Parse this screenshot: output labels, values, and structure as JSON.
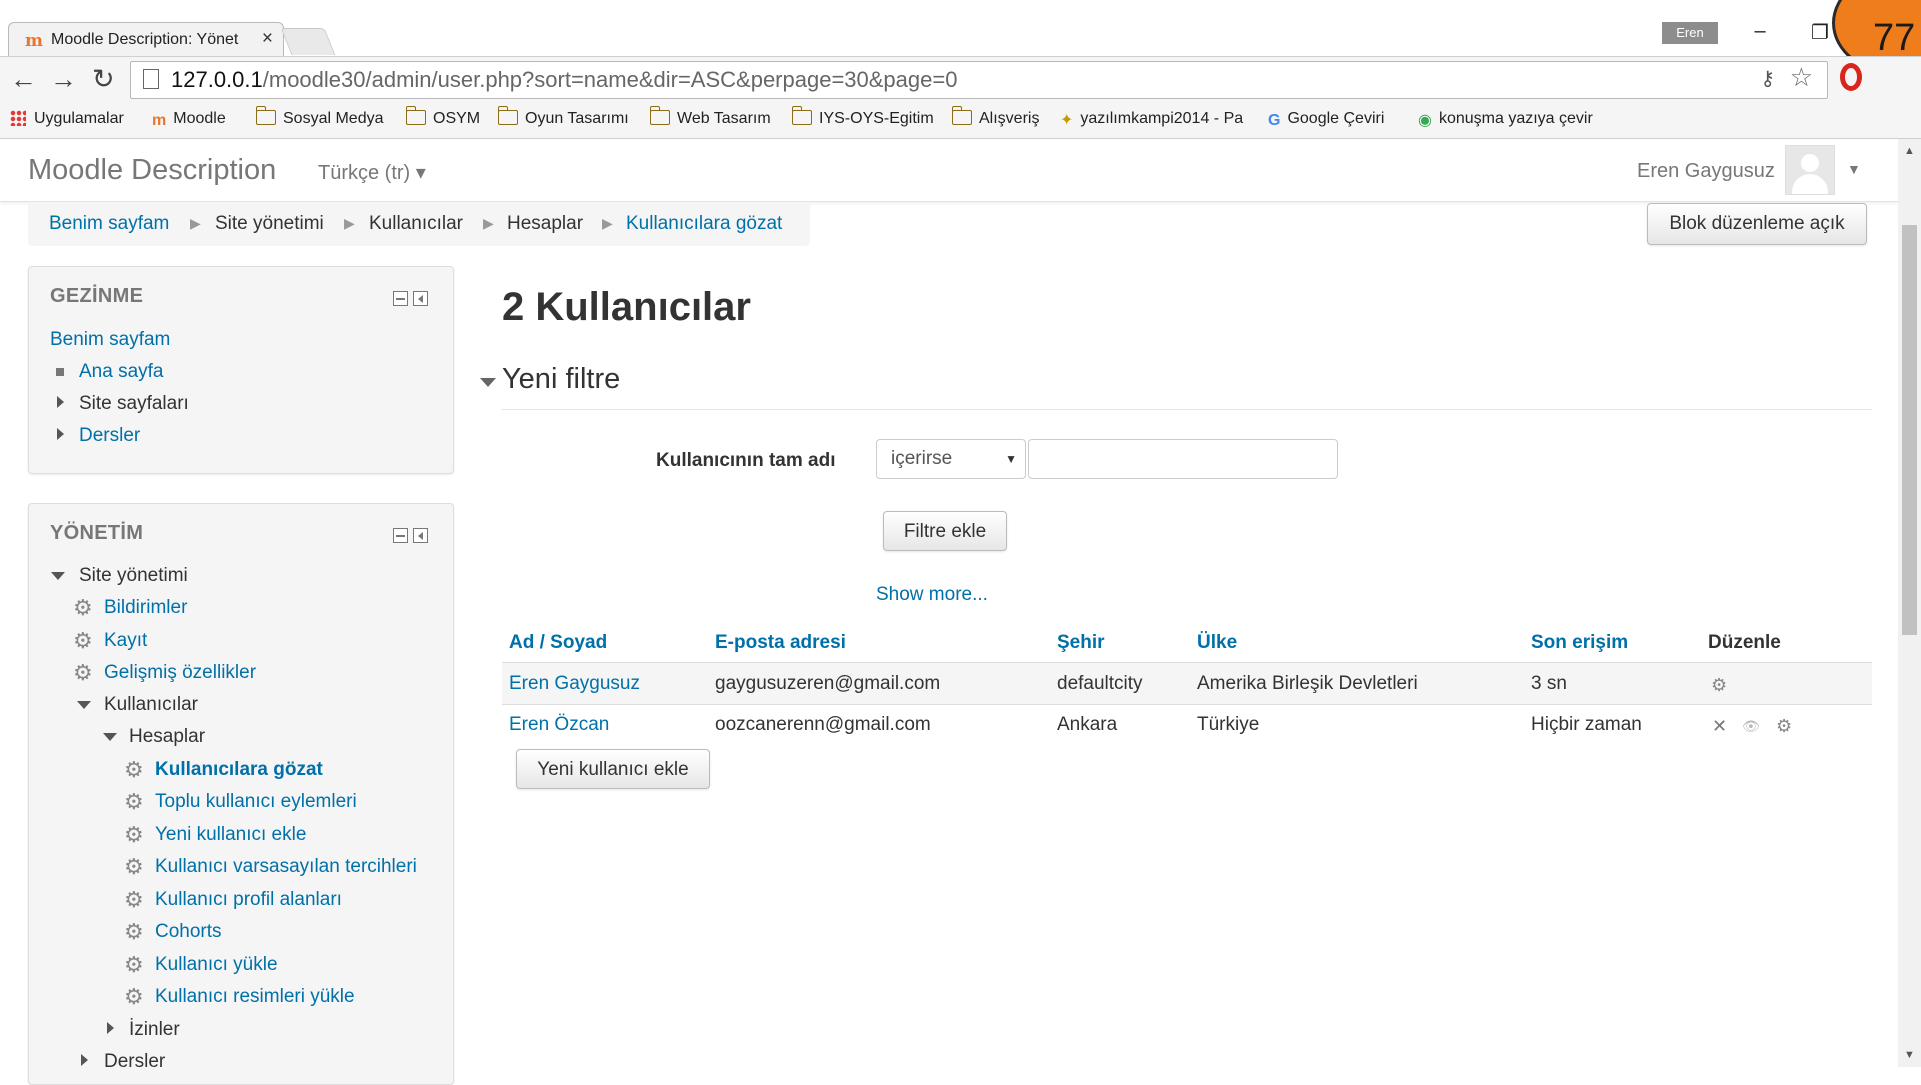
{
  "browser": {
    "tab_title": "Moodle Description: Yönet",
    "tab_close": "×",
    "profile_name": "Eren",
    "notification_count": "77",
    "url_host": "127.0.0.1",
    "url_path": "/moodle30/admin/user.php?sort=name&dir=ASC&perpage=30&page=0",
    "bookmarks": {
      "apps": "Uygulamalar",
      "moodle": "Moodle",
      "sosyal": "Sosyal Medya",
      "osym": "OSYM",
      "oyun": "Oyun Tasarımı",
      "web": "Web Tasarım",
      "iys": "IYS-OYS-Egitim",
      "alisveris": "Alışveriş",
      "yazilim": "yazılımkampi2014 - Pa",
      "ceviri": "Google Çeviri",
      "konusma": "konuşma yazıya çevir"
    }
  },
  "header": {
    "site_name": "Moodle Description",
    "language": "Türkçe (tr) ▾",
    "user_name": "Eren Gaygusuz"
  },
  "breadcrumb": [
    "Benim sayfam",
    "Site yönetimi",
    "Kullanıcılar",
    "Hesaplar",
    "Kullanıcılara gözat"
  ],
  "edit_blocks_button": "Blok düzenleme açık",
  "nav_block": {
    "title": "GEZİNME",
    "items": [
      "Benim sayfam",
      "Ana sayfa",
      "Site sayfaları",
      "Dersler"
    ]
  },
  "admin_block": {
    "title": "YÖNETİM",
    "site_admin": "Site yönetimi",
    "notifications": "Bildirimler",
    "registration": "Kayıt",
    "advanced": "Gelişmiş özellikler",
    "users": "Kullanıcılar",
    "accounts": "Hesaplar",
    "account_items": [
      "Kullanıcılara gözat",
      "Toplu kullanıcı eylemleri",
      "Yeni kullanıcı ekle",
      "Kullanıcı varsasayılan tercihleri",
      "Kullanıcı profil alanları",
      "Cohorts",
      "Kullanıcı yükle",
      "Kullanıcı resimleri yükle"
    ],
    "permissions": "İzinler",
    "courses": "Dersler"
  },
  "main": {
    "title": "2 Kullanıcılar",
    "filter_legend": "Yeni filtre",
    "filter_label": "Kullanıcının tam adı",
    "filter_operator": "içerirse",
    "filter_value": "",
    "add_filter_button": "Filtre ekle",
    "show_more": "Show more...",
    "columns": [
      "Ad / Soyad",
      "E-posta adresi",
      "Şehir",
      "Ülke",
      "Son erişim",
      "Düzenle"
    ],
    "rows": [
      {
        "name": "Eren Gaygusuz",
        "email": "gaygusuzeren@gmail.com",
        "city": "defaultcity",
        "country": "Amerika Birleşik Devletleri",
        "last_access": "3 sn"
      },
      {
        "name": "Eren Özcan",
        "email": "oozcanerenn@gmail.com",
        "city": "Ankara",
        "country": "Türkiye",
        "last_access": "Hiçbir zaman"
      }
    ],
    "add_user_button": "Yeni kullanıcı ekle"
  },
  "icons": {
    "gear": "⚙",
    "delete": "✕",
    "view": "👁",
    "page": "document-icon",
    "key": "🔑",
    "star": "☆"
  }
}
